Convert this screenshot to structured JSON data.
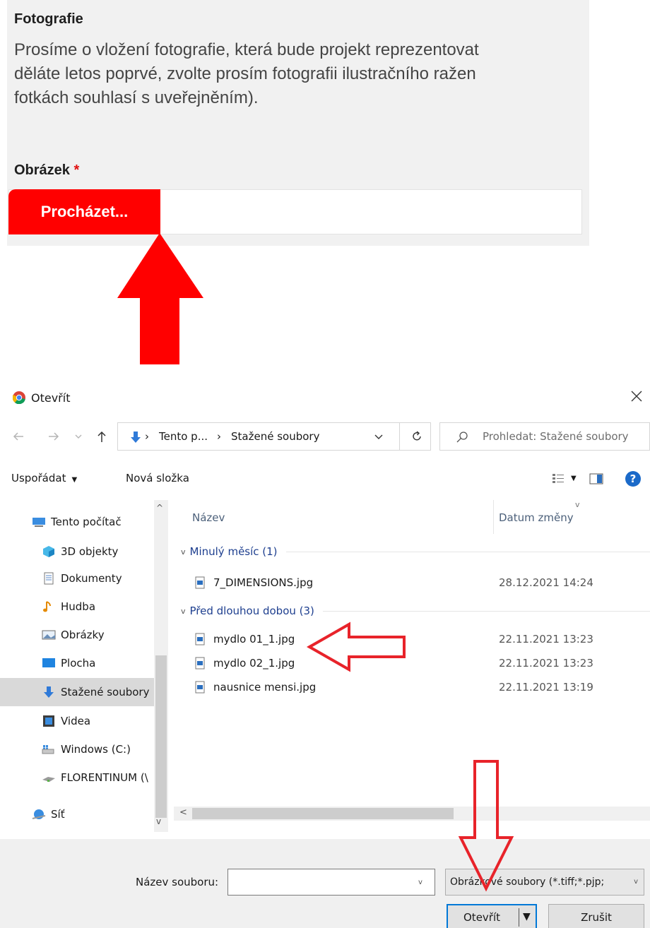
{
  "form": {
    "section_title": "Fotografie",
    "description_lines": [
      "Prosíme o vložení fotografie, která bude projekt reprezentovat",
      "děláte letos poprvé, zvolte prosím fotografii ilustračního ražen",
      "fotkách souhlasí s uveřejněním)."
    ],
    "field_label": "Obrázek",
    "required_mark": "*",
    "browse_label": "Procházet..."
  },
  "dialog": {
    "title": "Otevřít",
    "breadcrumb": [
      "Tento p...",
      "Stažené soubory"
    ],
    "search_placeholder": "Prohledat: Stažené soubory",
    "toolbar": {
      "organize": "Uspořádat",
      "new_folder": "Nová složka"
    },
    "nav_items": [
      {
        "label": "Tento počítač",
        "icon": "computer-icon"
      },
      {
        "label": "3D objekty",
        "icon": "cube-icon"
      },
      {
        "label": "Dokumenty",
        "icon": "document-icon"
      },
      {
        "label": "Hudba",
        "icon": "music-icon"
      },
      {
        "label": "Obrázky",
        "icon": "pictures-icon"
      },
      {
        "label": "Plocha",
        "icon": "desktop-icon"
      },
      {
        "label": "Stažené soubory",
        "icon": "download-icon",
        "selected": true
      },
      {
        "label": "Videa",
        "icon": "video-icon"
      },
      {
        "label": "Windows (C:)",
        "icon": "drive-icon"
      },
      {
        "label": "FLORENTINUM (\\",
        "icon": "network-drive-icon"
      },
      {
        "label": "Síť",
        "icon": "network-icon"
      }
    ],
    "columns": {
      "name": "Název",
      "date": "Datum změny"
    },
    "groups": [
      {
        "label": "Minulý měsíc (1)",
        "files": [
          {
            "name": "7_DIMENSIONS.jpg",
            "date": "28.12.2021 14:24"
          }
        ]
      },
      {
        "label": "Před dlouhou dobou (3)",
        "files": [
          {
            "name": "mydlo 01_1.jpg",
            "date": "22.11.2021 13:23"
          },
          {
            "name": "mydlo 02_1.jpg",
            "date": "22.11.2021 13:23"
          },
          {
            "name": "nausnice mensi.jpg",
            "date": "22.11.2021 13:19"
          }
        ]
      }
    ],
    "filename_label": "Název souboru:",
    "filename_value": "",
    "filetype_label": "Obrázkové soubory (*.tiff;*.pjp;",
    "open_label": "Otevřít",
    "cancel_label": "Zrušit"
  },
  "colors": {
    "accent_red": "#ff0000",
    "form_background": "#f1f1f1",
    "dialog_accent": "#0078d7",
    "link_blue": "#1e3f8f"
  }
}
